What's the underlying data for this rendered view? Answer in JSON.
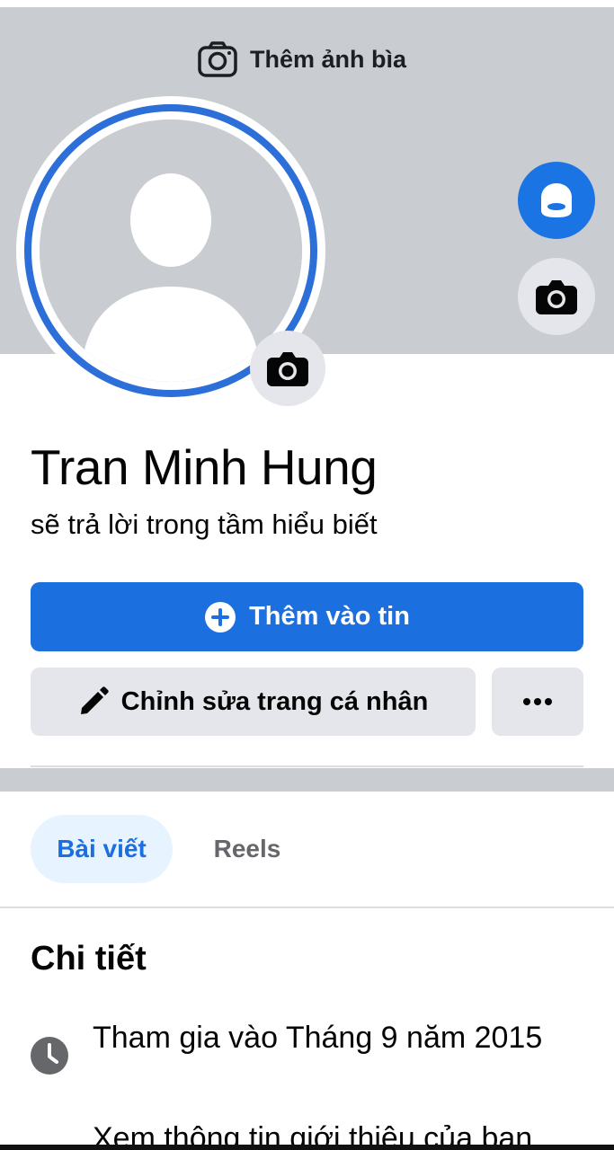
{
  "cover": {
    "add_cover_label": "Thêm ảnh bìa",
    "background_color": "#c9ccd1"
  },
  "icons": {
    "cover_camera": "camera-outline-icon",
    "avatar_camera": "camera-icon",
    "avatar_shortcut": "avatar-shortcut-icon",
    "cover_side_camera": "camera-icon",
    "add_story": "plus-circle-icon",
    "edit": "pencil-icon",
    "more": "more-dots-icon",
    "joined": "clock-icon"
  },
  "profile": {
    "name": "Tran Minh Hung",
    "bio": "sẽ trả lời trong tầm hiểu biết"
  },
  "actions": {
    "add_story_label": "Thêm vào tin",
    "edit_profile_label": "Chỉnh sửa trang cá nhân"
  },
  "tabs": [
    {
      "label": "Bài viết",
      "active": true
    },
    {
      "label": "Reels",
      "active": false
    }
  ],
  "details": {
    "title": "Chi tiết",
    "joined": "Tham gia vào Tháng 9 năm 2015",
    "see_more_partial": "Xem thông tin giới thiệu của bạn"
  },
  "colors": {
    "accent": "#1b6fde",
    "accent_light": "#e7f3ff",
    "button_gray": "#e4e6eb",
    "text_primary": "#050505",
    "text_secondary": "#65676b"
  }
}
